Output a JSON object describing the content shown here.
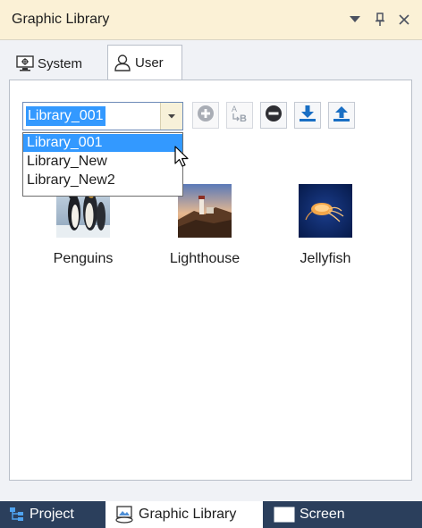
{
  "panel": {
    "title": "Graphic Library",
    "buttons": {
      "dropdown": "window-position-menu",
      "pin": "pin",
      "close": "close"
    }
  },
  "tabs": [
    {
      "label": "System",
      "icon": "monitor-icon",
      "active": false
    },
    {
      "label": "User",
      "icon": "user-icon",
      "active": true
    }
  ],
  "library": {
    "selected": "Library_001",
    "options": [
      "Library_001",
      "Library_New",
      "Library_New2"
    ],
    "highlighted_index": 0
  },
  "toolbar": [
    {
      "name": "add-library-button",
      "icon": "plus-circle-icon",
      "enabled": false
    },
    {
      "name": "rename-library-button",
      "icon": "rename-ab-icon",
      "enabled": false
    },
    {
      "name": "delete-library-button",
      "icon": "minus-circle-icon",
      "enabled": true
    },
    {
      "name": "import-button",
      "icon": "download-icon",
      "enabled": true
    },
    {
      "name": "export-button",
      "icon": "upload-icon",
      "enabled": true
    }
  ],
  "graphics": [
    {
      "label": "Penguins"
    },
    {
      "label": "Lighthouse"
    },
    {
      "label": "Jellyfish"
    }
  ],
  "bottom_tabs": [
    {
      "label": "Project",
      "icon": "project-tree-icon",
      "active": false
    },
    {
      "label": "Graphic Library",
      "icon": "graphic-library-icon",
      "active": true
    },
    {
      "label": "Screen",
      "icon": "screen-icon",
      "active": false
    }
  ],
  "colors": {
    "accent": "#3399ff",
    "titlebar": "#fbf1d6",
    "bottombar": "#2b3f5c",
    "icon_blue": "#1a6fc4"
  }
}
